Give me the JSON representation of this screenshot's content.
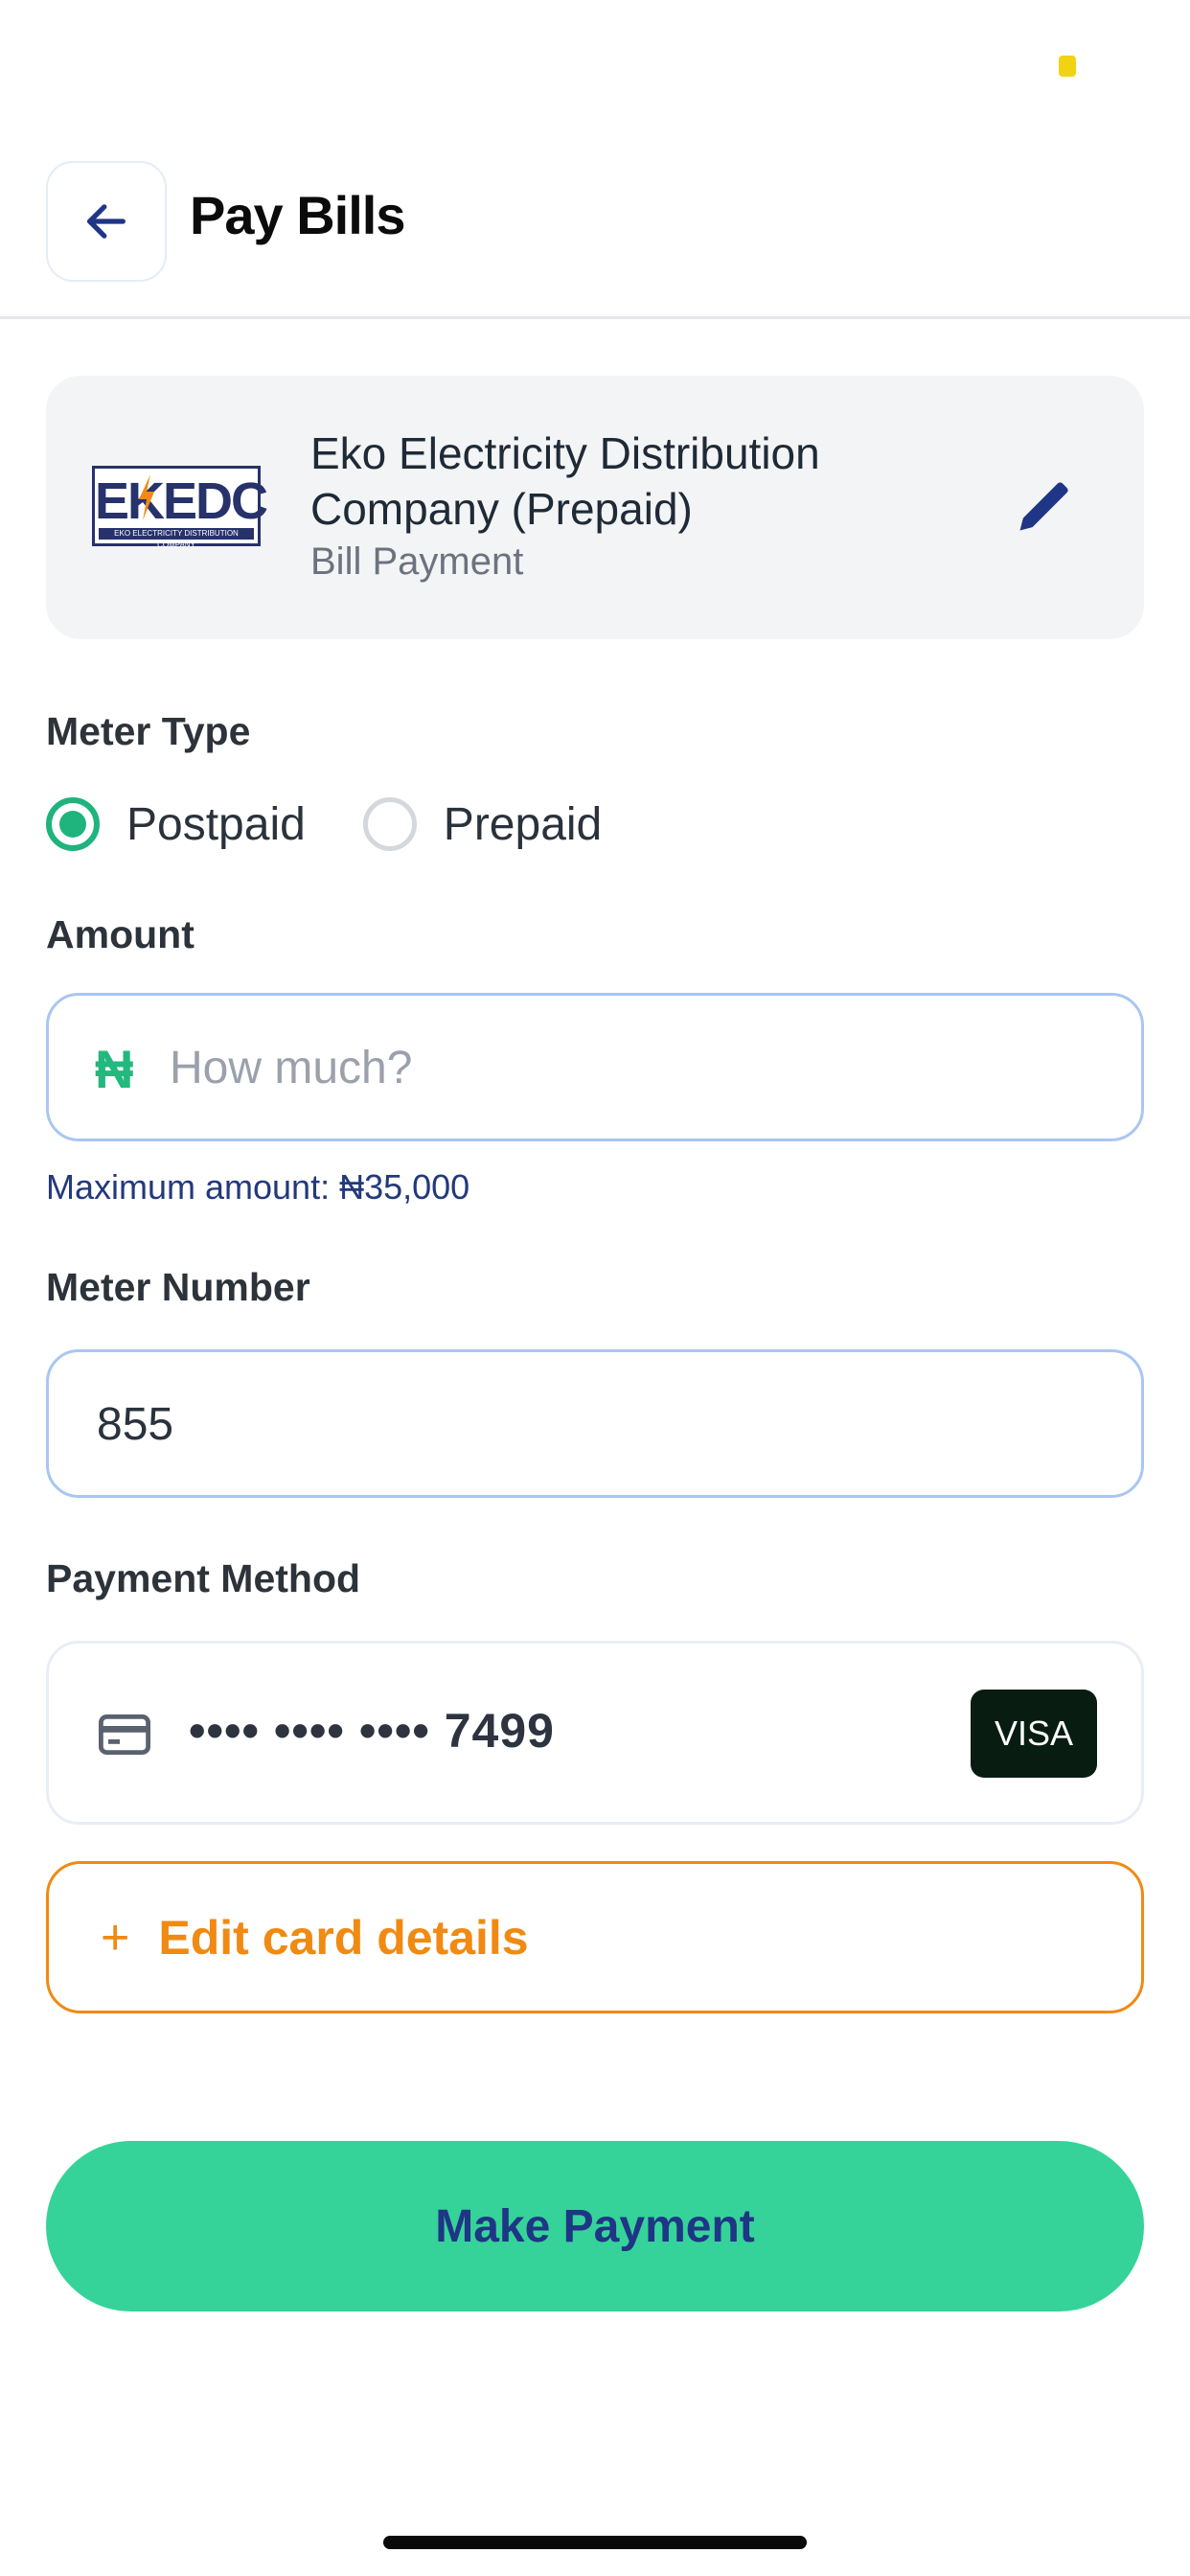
{
  "header": {
    "title": "Pay Bills",
    "back_icon": "arrow-left-icon"
  },
  "biller": {
    "logo_text": "EKEDC",
    "logo_subtext": "EKO ELECTRICITY DISTRIBUTION COMPANY",
    "name": "Eko Electricity Distribution Company (Prepaid)",
    "subtitle": "Bill Payment",
    "edit_icon": "pencil-icon"
  },
  "meter_type": {
    "label": "Meter Type",
    "options": [
      {
        "label": "Postpaid",
        "selected": true
      },
      {
        "label": "Prepaid",
        "selected": false
      }
    ]
  },
  "amount": {
    "label": "Amount",
    "currency_symbol": "₦",
    "placeholder": "How much?",
    "value": "",
    "max_note": "Maximum amount: ₦35,000"
  },
  "meter_number": {
    "label": "Meter Number",
    "value": "855"
  },
  "payment_method": {
    "label": "Payment Method",
    "card_icon": "credit-card-icon",
    "card_number": "•••• •••• •••• 7499",
    "card_brand": "VISA"
  },
  "edit_card": {
    "icon": "plus-icon",
    "label": "Edit card details"
  },
  "submit": {
    "label": "Make Payment"
  },
  "colors": {
    "accent_green": "#35d399",
    "radio_green": "#1fb37e",
    "orange": "#f08a12",
    "navy": "#1f3585",
    "field_border": "#a9c6f3"
  }
}
